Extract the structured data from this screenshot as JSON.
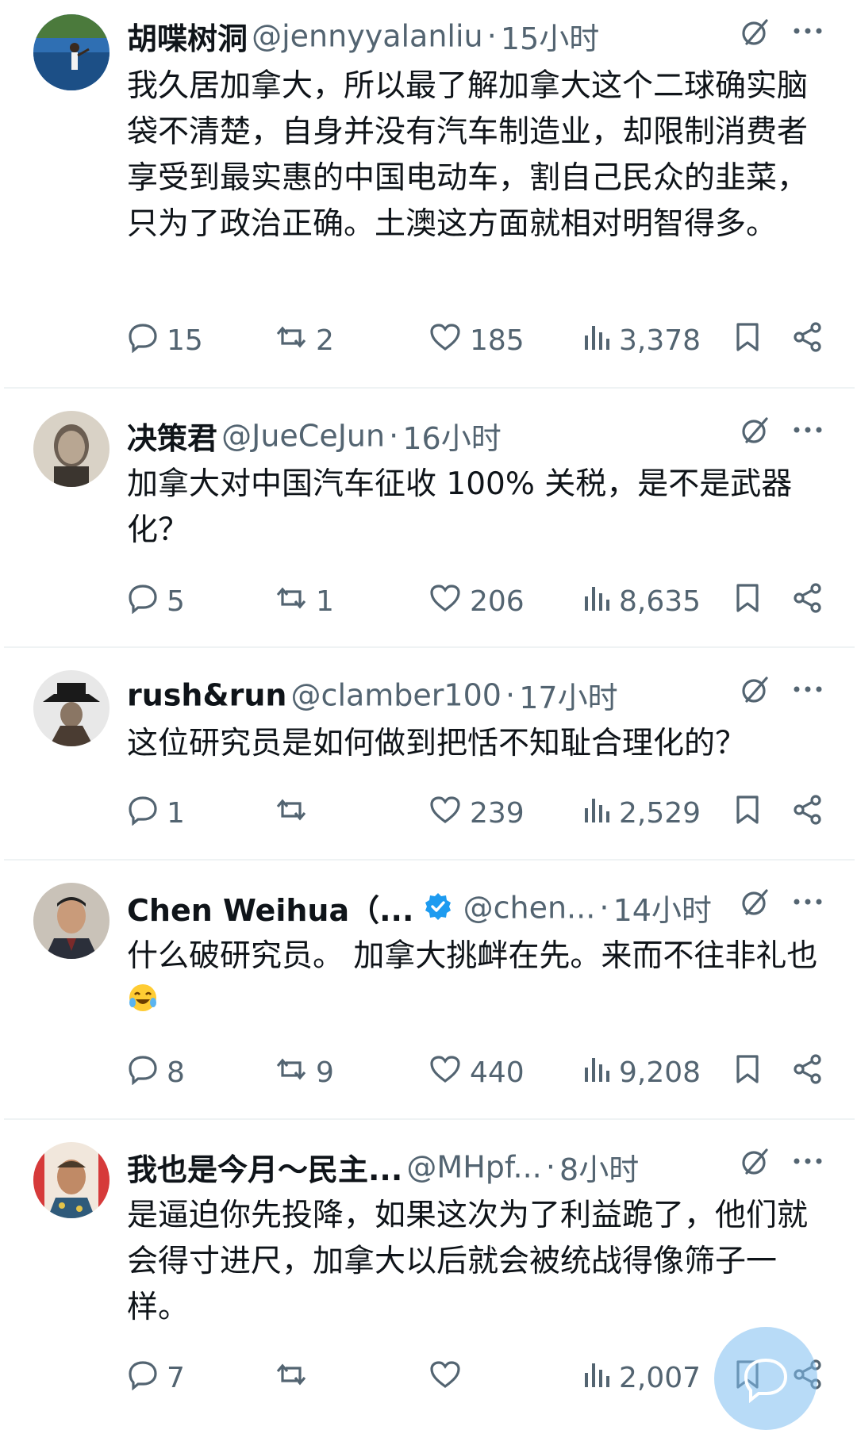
{
  "replies": [
    {
      "name": "胡喋树洞",
      "handle": "@jennyyalanliu",
      "time": "15小时",
      "text": "我久居加拿大，所以最了解加拿大这个二球确实脑袋不清楚，自身并没有汽车制造业，却限制消费者享受到最实惠的中国电动车，割自己民众的韭菜，只为了政治正确。土澳这方面就相对明智得多。",
      "replies": "15",
      "reposts": "2",
      "likes": "185",
      "views": "3,378"
    },
    {
      "name": "决策君",
      "handle": "@JueCeJun",
      "time": "16小时",
      "text": "加拿大对中国汽车征收 100% 关税，是不是武器化？",
      "replies": "5",
      "reposts": "1",
      "likes": "206",
      "views": "8,635"
    },
    {
      "name": "rush&run",
      "handle": "@clamber100",
      "time": "17小时",
      "text": "这位研究员是如何做到把恬不知耻合理化的？",
      "replies": "1",
      "reposts": "",
      "likes": "239",
      "views": "2,529"
    },
    {
      "name": "Chen Weihua（...",
      "handle": "@chen...",
      "time": "14小时",
      "text": "什么破研究员。 加拿大挑衅在先。来而不往非礼也",
      "replies": "8",
      "reposts": "9",
      "likes": "440",
      "views": "9,208"
    },
    {
      "name": "我也是今月～民主...",
      "handle": "@MHpf...",
      "time": "8小时",
      "text": "是逼迫你先投降，如果这次为了利益跪了，他们就会得寸进尺，加拿大以后就会被统战得像筛子一样。",
      "replies": "7",
      "reposts": "",
      "likes": "",
      "views": "2,007"
    }
  ],
  "separator": "·",
  "icons": {
    "grok": "grok-icon",
    "more": "more-icon",
    "reply": "reply-icon",
    "repost": "repost-icon",
    "like": "heart-icon",
    "views": "views-icon",
    "bookmark": "bookmark-icon",
    "share": "share-icon",
    "verified": "verified-badge-icon",
    "fab": "compose-reply-icon"
  },
  "colors": {
    "text": "#0f1419",
    "muted": "#536471",
    "verified": "#1d9bf0",
    "divider": "#eff3f4"
  }
}
